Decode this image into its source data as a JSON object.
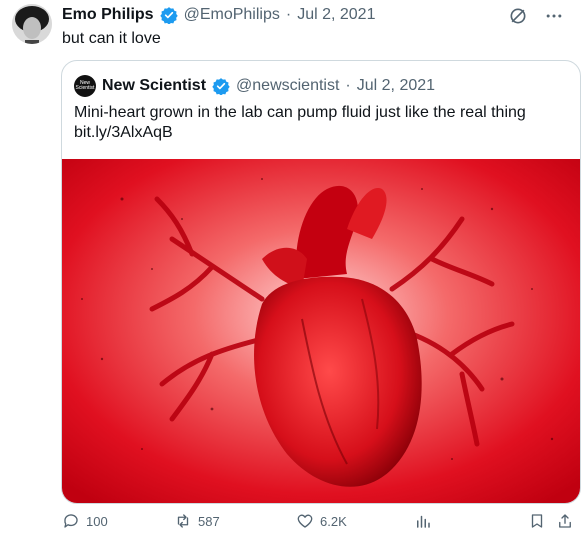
{
  "author": {
    "display_name": "Emo Philips",
    "handle": "@EmoPhilips",
    "separator": "·",
    "date": "Jul 2, 2021",
    "text": "but can it love"
  },
  "quoted": {
    "display_name": "New Scientist",
    "avatar_text": "New Scientist",
    "handle": "@newscientist",
    "separator": "·",
    "date": "Jul 2, 2021",
    "text_line1": "Mini-heart grown in the lab can pump fluid just like the real thing",
    "text_line2": "bit.ly/3AlxAqB"
  },
  "actions": {
    "replies": "100",
    "reposts": "587",
    "likes": "6.2K"
  },
  "colors": {
    "verified": "#1d9bf0",
    "muted": "#536471",
    "image_red": "#e01020"
  },
  "icons": [
    "verified-badge-icon",
    "grok-icon",
    "more-icon",
    "reply-icon",
    "repost-icon",
    "like-icon",
    "views-icon",
    "bookmark-icon",
    "share-icon"
  ]
}
